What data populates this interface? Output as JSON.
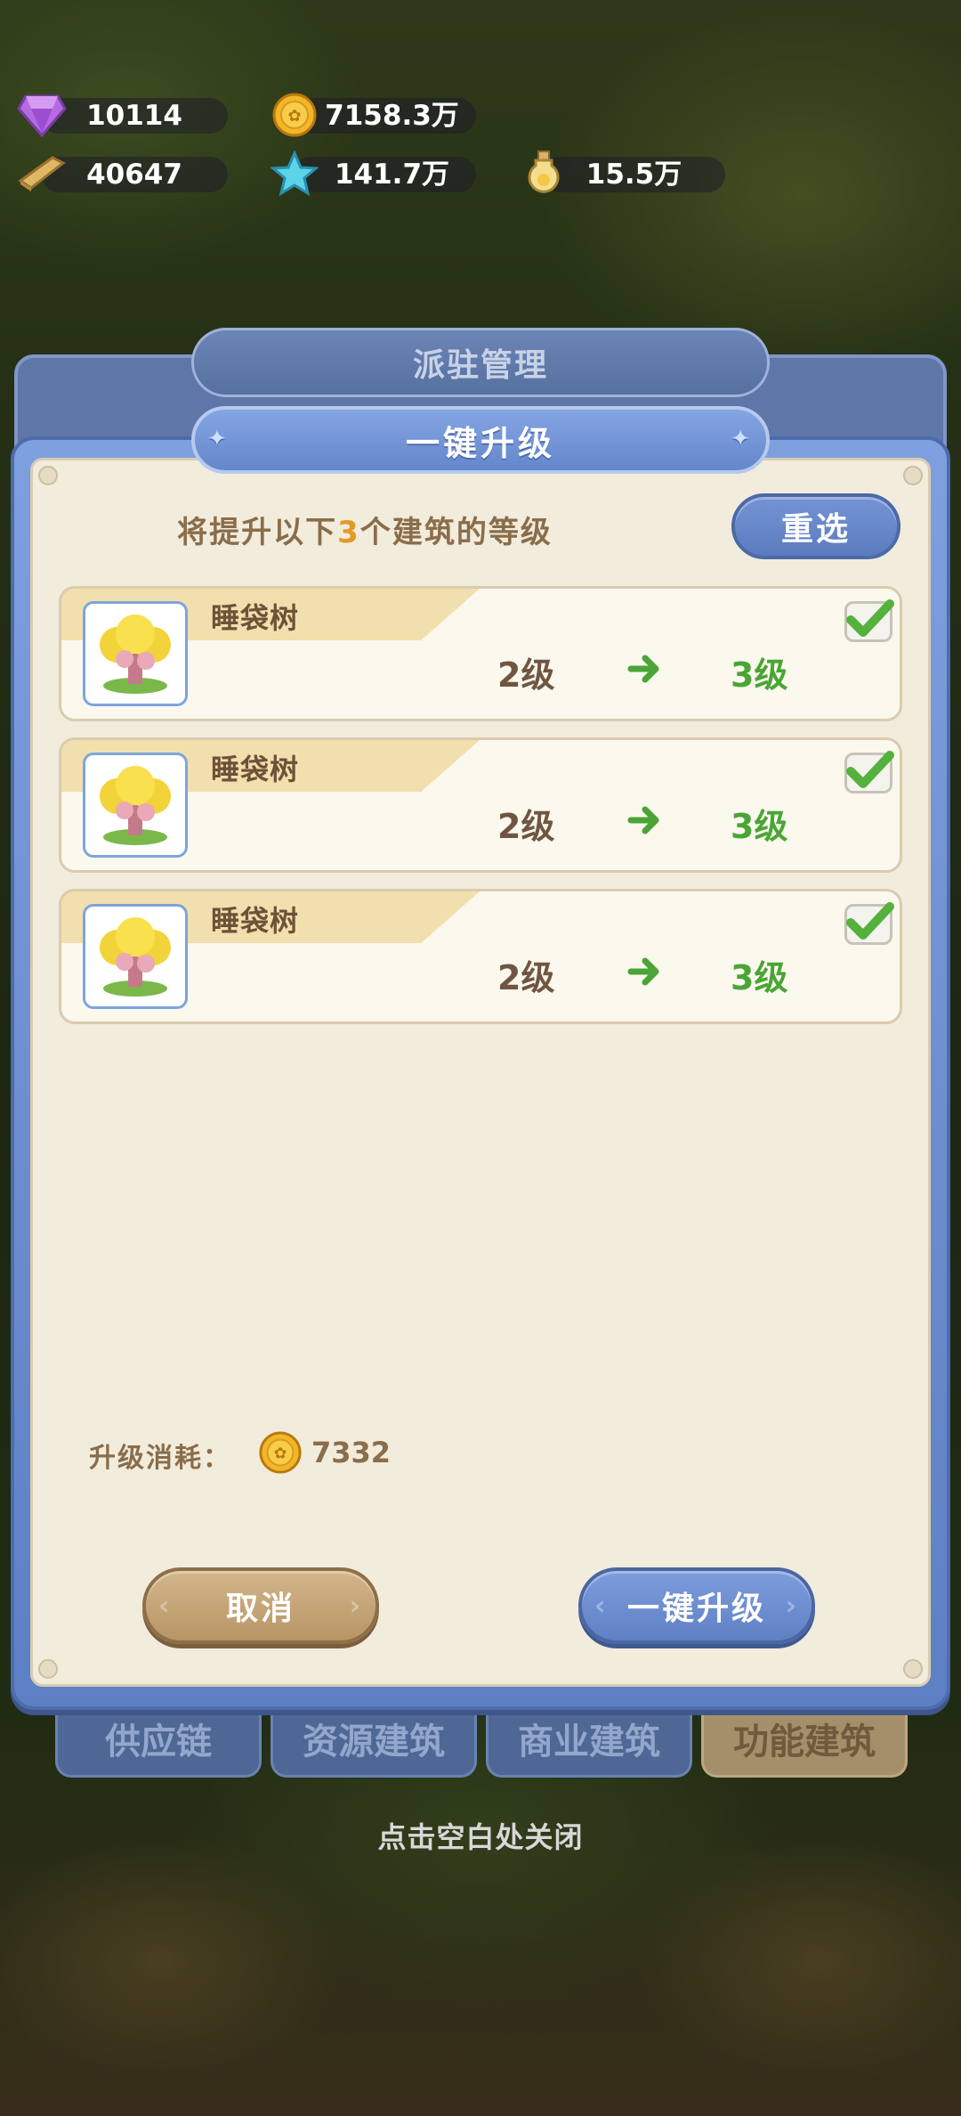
{
  "resources": [
    {
      "icon": "diamond-icon",
      "value": "10114"
    },
    {
      "icon": "gold-coin-icon",
      "value": "7158.3万"
    },
    {
      "icon": "wood-plank-icon",
      "value": "40647"
    },
    {
      "icon": "blue-star-icon",
      "value": "141.7万"
    },
    {
      "icon": "potion-bottle-icon",
      "value": "15.5万"
    }
  ],
  "back_panel": {
    "title": "派驻管理",
    "tabs": [
      {
        "label": "供应链",
        "badge": false,
        "active": false
      },
      {
        "label": "资源建筑",
        "badge": true,
        "active": false
      },
      {
        "label": "商业建筑",
        "badge": false,
        "active": false
      },
      {
        "label": "功能建筑",
        "badge": true,
        "active": true
      }
    ]
  },
  "dialog": {
    "title": "一键升级",
    "hint_prefix": "将提升以下",
    "hint_count": "3",
    "hint_suffix": "个建筑的等级",
    "reselect_label": "重选",
    "buildings": [
      {
        "name": "睡袋树",
        "from_level": "2级",
        "to_level": "3级",
        "checked": true
      },
      {
        "name": "睡袋树",
        "from_level": "2级",
        "to_level": "3级",
        "checked": true
      },
      {
        "name": "睡袋树",
        "from_level": "2级",
        "to_level": "3级",
        "checked": true
      }
    ],
    "cost_label": "升级消耗：",
    "cost_value": "7332",
    "cancel_label": "取消",
    "confirm_label": "一键升级"
  },
  "close_hint": "点击空白处关闭",
  "colors": {
    "panel_blue": "#6487cc",
    "panel_bg": "#f2ecdd",
    "level_up_green": "#4aa536",
    "count_orange": "#e39a27"
  }
}
